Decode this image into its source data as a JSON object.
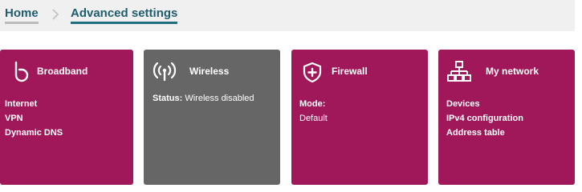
{
  "breadcrumb": {
    "home_label": "Home",
    "current_label": "Advanced settings"
  },
  "cards": [
    {
      "title": "Broadband",
      "icon": "broadband-icon",
      "items": [
        "Internet",
        "VPN",
        "Dynamic DNS"
      ]
    },
    {
      "title": "Wireless",
      "icon": "wireless-signal-icon",
      "status_label": "Status:",
      "status_value": "Wireless disabled"
    },
    {
      "title": "Firewall",
      "icon": "shield-plus-icon",
      "mode_label": "Mode:",
      "mode_value": "Default"
    },
    {
      "title": "My network",
      "icon": "network-tree-icon",
      "items": [
        "Devices",
        "IPv4 configuration",
        "Address table"
      ]
    }
  ],
  "colors": {
    "card_accent": "#a0185a",
    "card_disabled": "#666666",
    "breadcrumb_text": "#1f5d6e"
  }
}
